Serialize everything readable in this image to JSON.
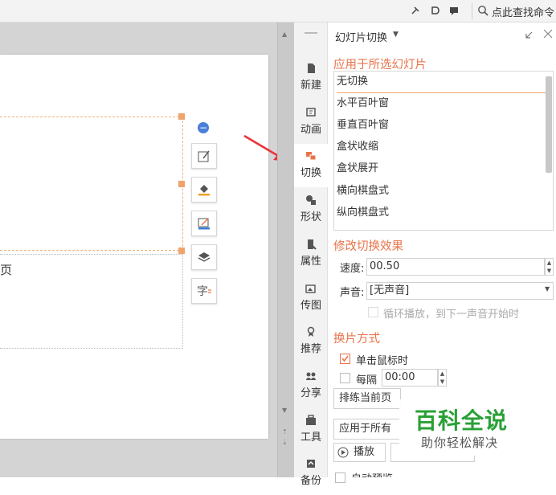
{
  "topbar": {
    "search_text": "点此查找命令"
  },
  "slide": {
    "text_fragment": "页"
  },
  "sidebar": {
    "tabs": [
      {
        "label": "新建",
        "icon": "new-icon"
      },
      {
        "label": "动画",
        "icon": "animation-icon"
      },
      {
        "label": "切换",
        "icon": "transition-icon",
        "active": true
      },
      {
        "label": "形状",
        "icon": "shape-icon"
      },
      {
        "label": "属性",
        "icon": "properties-icon"
      },
      {
        "label": "传图",
        "icon": "upload-image-icon"
      },
      {
        "label": "推荐",
        "icon": "recommend-icon"
      },
      {
        "label": "分享",
        "icon": "share-icon"
      },
      {
        "label": "工具",
        "icon": "toolbox-icon"
      },
      {
        "label": "备份",
        "icon": "backup-icon"
      }
    ]
  },
  "panel": {
    "title": "幻灯片切换",
    "apply_section": "应用于所选幻灯片",
    "transitions": [
      "无切换",
      "水平百叶窗",
      "垂直百叶窗",
      "盒状收缩",
      "盒状展开",
      "横向棋盘式",
      "纵向棋盘式"
    ],
    "selected_transition": "无切换",
    "modify_section": "修改切换效果",
    "speed_label": "速度:",
    "speed_value": "00.50",
    "sound_label": "声音:",
    "sound_value": "[无声音]",
    "loop_label": "循环播放，到下一声音开始时",
    "advance_section": "换片方式",
    "on_click_label": "单击鼠标时",
    "on_click_checked": true,
    "every_label": "每隔",
    "every_value": "00:00",
    "every_checked": false,
    "rehearse_button": "排练当前页",
    "apply_all_button": "应用于所有",
    "play_button": "播放",
    "auto_preview_label": "自动预览"
  },
  "watermark": {
    "title": "百科全说",
    "subtitle": "助你轻松解决"
  },
  "colors": {
    "accent": "#e8734a",
    "arrow": "#e8343a",
    "watermark": "#2aa036"
  }
}
